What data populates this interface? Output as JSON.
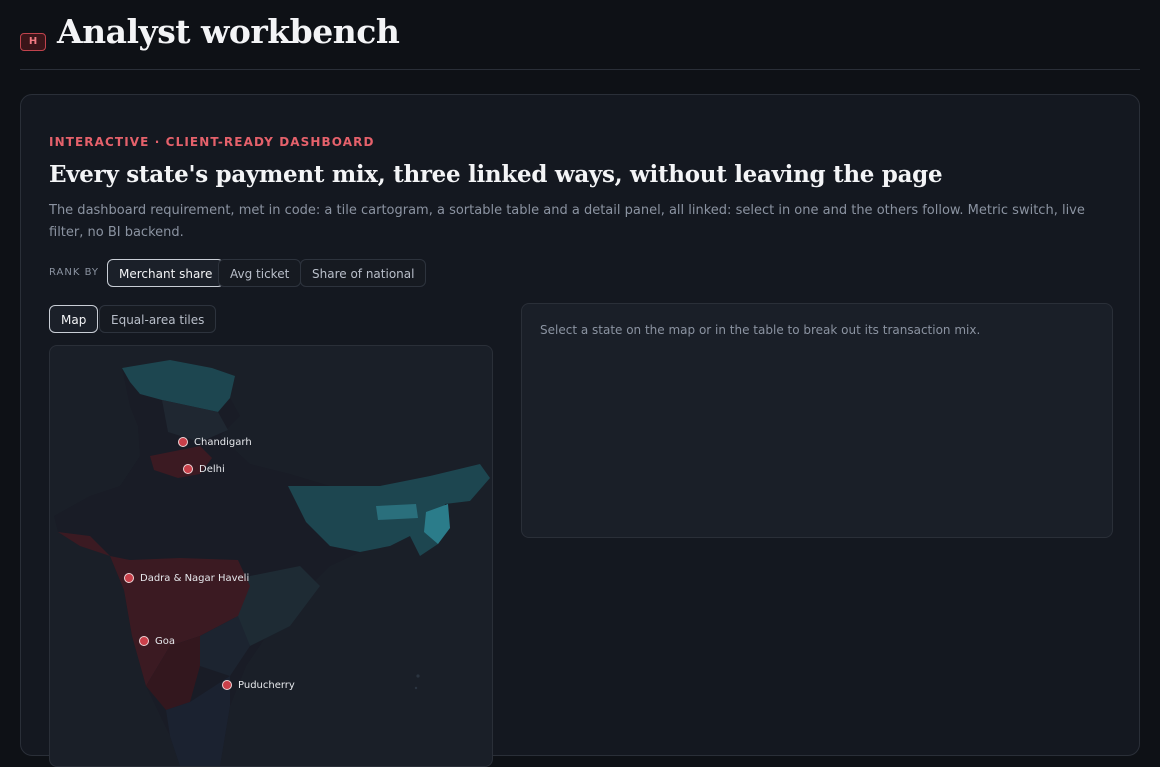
{
  "header": {
    "badge": "H",
    "title": "Analyst workbench"
  },
  "dashboard": {
    "eyebrow": "INTERACTIVE · CLIENT-READY DASHBOARD",
    "headline": "Every state's payment mix, three linked ways, without leaving the page",
    "description": "The dashboard requirement, met in code: a tile cartogram, a sortable table and a detail panel, all linked: select in one and the others follow. Metric switch, live filter, no BI backend.",
    "rank_by": {
      "label": "RANK BY",
      "options": [
        "Merchant share",
        "Avg ticket",
        "Share of national"
      ],
      "selected": "Merchant share"
    },
    "view_toggle": {
      "options": [
        "Map",
        "Equal-area tiles"
      ],
      "selected": "Map"
    },
    "map": {
      "union_territories": [
        "Chandigarh",
        "Delhi",
        "Dadra & Nagar Haveli",
        "Goa",
        "Puducherry"
      ],
      "colors": {
        "low": "#1b1f2a",
        "mid_teal": "#1d4650",
        "high_teal": "#2b7c8a",
        "maroon": "#3b1a22",
        "marker": "#c9404a"
      }
    },
    "detail": {
      "empty_message": "Select a state on the map or in the table to break out its transaction mix."
    }
  }
}
